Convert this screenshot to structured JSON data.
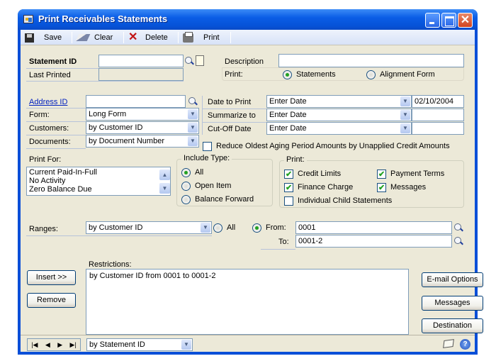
{
  "window": {
    "title": "Print Receivables Statements",
    "controls": {
      "minimize": "minimize",
      "maximize": "maximize",
      "close": "✕"
    }
  },
  "toolbar": {
    "save": "Save",
    "clear": "Clear",
    "delete": "Delete",
    "print": "Print"
  },
  "header": {
    "statement_id_label": "Statement ID",
    "statement_id_value": "",
    "last_printed_label": "Last Printed",
    "last_printed_value": "",
    "description_label": "Description",
    "description_value": "",
    "print_label": "Print:",
    "print_options": [
      {
        "label": "Statements",
        "selected": true
      },
      {
        "label": "Alignment Form",
        "selected": false
      }
    ]
  },
  "options": {
    "address_id_label": "Address ID",
    "address_id_value": "",
    "form_label": "Form:",
    "form_value": "Long Form",
    "customers_label": "Customers:",
    "customers_value": "by Customer ID",
    "documents_label": "Documents:",
    "documents_value": "by Document Number",
    "date_to_print_label": "Date to Print",
    "date_to_print_mode": "Enter Date",
    "date_to_print_value": "02/10/2004",
    "summarize_to_label": "Summarize to",
    "summarize_to_mode": "Enter Date",
    "summarize_to_value": "",
    "cutoff_date_label": "Cut-Off Date",
    "cutoff_date_mode": "Enter Date",
    "cutoff_date_value": "",
    "reduce_oldest_label": "Reduce Oldest Aging Period Amounts by Unapplied Credit Amounts",
    "reduce_oldest_checked": false
  },
  "print_for": {
    "label": "Print For:",
    "items": [
      "Current Paid-In-Full",
      "No Activity",
      "Zero Balance Due"
    ]
  },
  "include_type": {
    "label": "Include Type:",
    "options": [
      {
        "label": "All",
        "selected": true
      },
      {
        "label": "Open Item",
        "selected": false
      },
      {
        "label": "Balance Forward",
        "selected": false
      }
    ]
  },
  "print_group": {
    "label": "Print:",
    "options": [
      {
        "label": "Credit Limits",
        "checked": true
      },
      {
        "label": "Payment Terms",
        "checked": true
      },
      {
        "label": "Finance Charge",
        "checked": true
      },
      {
        "label": "Messages",
        "checked": true
      },
      {
        "label": "Individual Child Statements",
        "checked": false
      }
    ]
  },
  "ranges": {
    "label": "Ranges:",
    "value": "by Customer ID",
    "all_label": "All",
    "all_selected": false,
    "from_label": "From:",
    "from_selected": true,
    "from_value": "0001",
    "to_label": "To:",
    "to_value": "0001-2"
  },
  "restrictions": {
    "label": "Restrictions:",
    "items": [
      "by Customer ID from 0001 to 0001-2"
    ],
    "insert_button": "Insert >>",
    "remove_button": "Remove"
  },
  "side_buttons": {
    "email_options": "E-mail Options",
    "messages": "Messages",
    "destination": "Destination"
  },
  "statusbar": {
    "nav": [
      "|◀",
      "◀",
      "▶",
      "▶|"
    ],
    "sort_value": "by Statement ID",
    "help": "?"
  }
}
